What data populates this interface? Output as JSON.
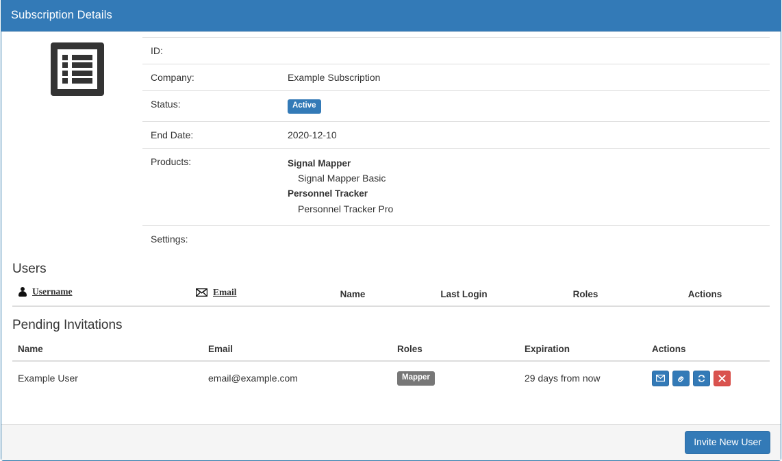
{
  "panel": {
    "title": "Subscription Details",
    "header_color": "#337ab7",
    "icon": "list-icon"
  },
  "details": {
    "rows": [
      {
        "label": "ID:",
        "value": ""
      },
      {
        "label": "Company:",
        "value": "Example Subscription"
      },
      {
        "label": "Status:",
        "value": "Active"
      },
      {
        "label": "End Date:",
        "value": "2020-12-10"
      },
      {
        "label": "Products:",
        "value": ""
      },
      {
        "label": "Settings:",
        "value": ""
      }
    ],
    "status_badge": {
      "text": "Active",
      "color": "#337ab7"
    },
    "products": [
      {
        "group": "Signal Mapper",
        "item": "Signal Mapper Basic"
      },
      {
        "group": "Personnel Tracker",
        "item": "Personnel Tracker Pro"
      }
    ]
  },
  "users": {
    "title": "Users",
    "columns": {
      "username": "Username",
      "email": "Email",
      "name": "Name",
      "last_login": "Last Login",
      "roles": "Roles",
      "actions": "Actions"
    },
    "icons": {
      "username": "person-icon",
      "email": "envelope-icon"
    },
    "rows": []
  },
  "invitations": {
    "title": "Pending Invitations",
    "columns": {
      "name": "Name",
      "email": "Email",
      "roles": "Roles",
      "expiration": "Expiration",
      "actions": "Actions"
    },
    "rows": [
      {
        "name": "Example User",
        "email": "email@example.com",
        "role": "Mapper",
        "role_color": "#777777",
        "expiration": "29 days from now",
        "actions": [
          {
            "name": "resend-invitation-button",
            "icon": "envelope-icon",
            "color": "#337ab7"
          },
          {
            "name": "copy-invitation-link-button",
            "icon": "link-icon",
            "color": "#337ab7"
          },
          {
            "name": "refresh-invitation-button",
            "icon": "refresh-icon",
            "color": "#337ab7"
          },
          {
            "name": "delete-invitation-button",
            "icon": "close-icon",
            "color": "#d9534f"
          }
        ]
      }
    ]
  },
  "footer": {
    "invite_button": "Invite New User",
    "button_color": "#337ab7"
  }
}
